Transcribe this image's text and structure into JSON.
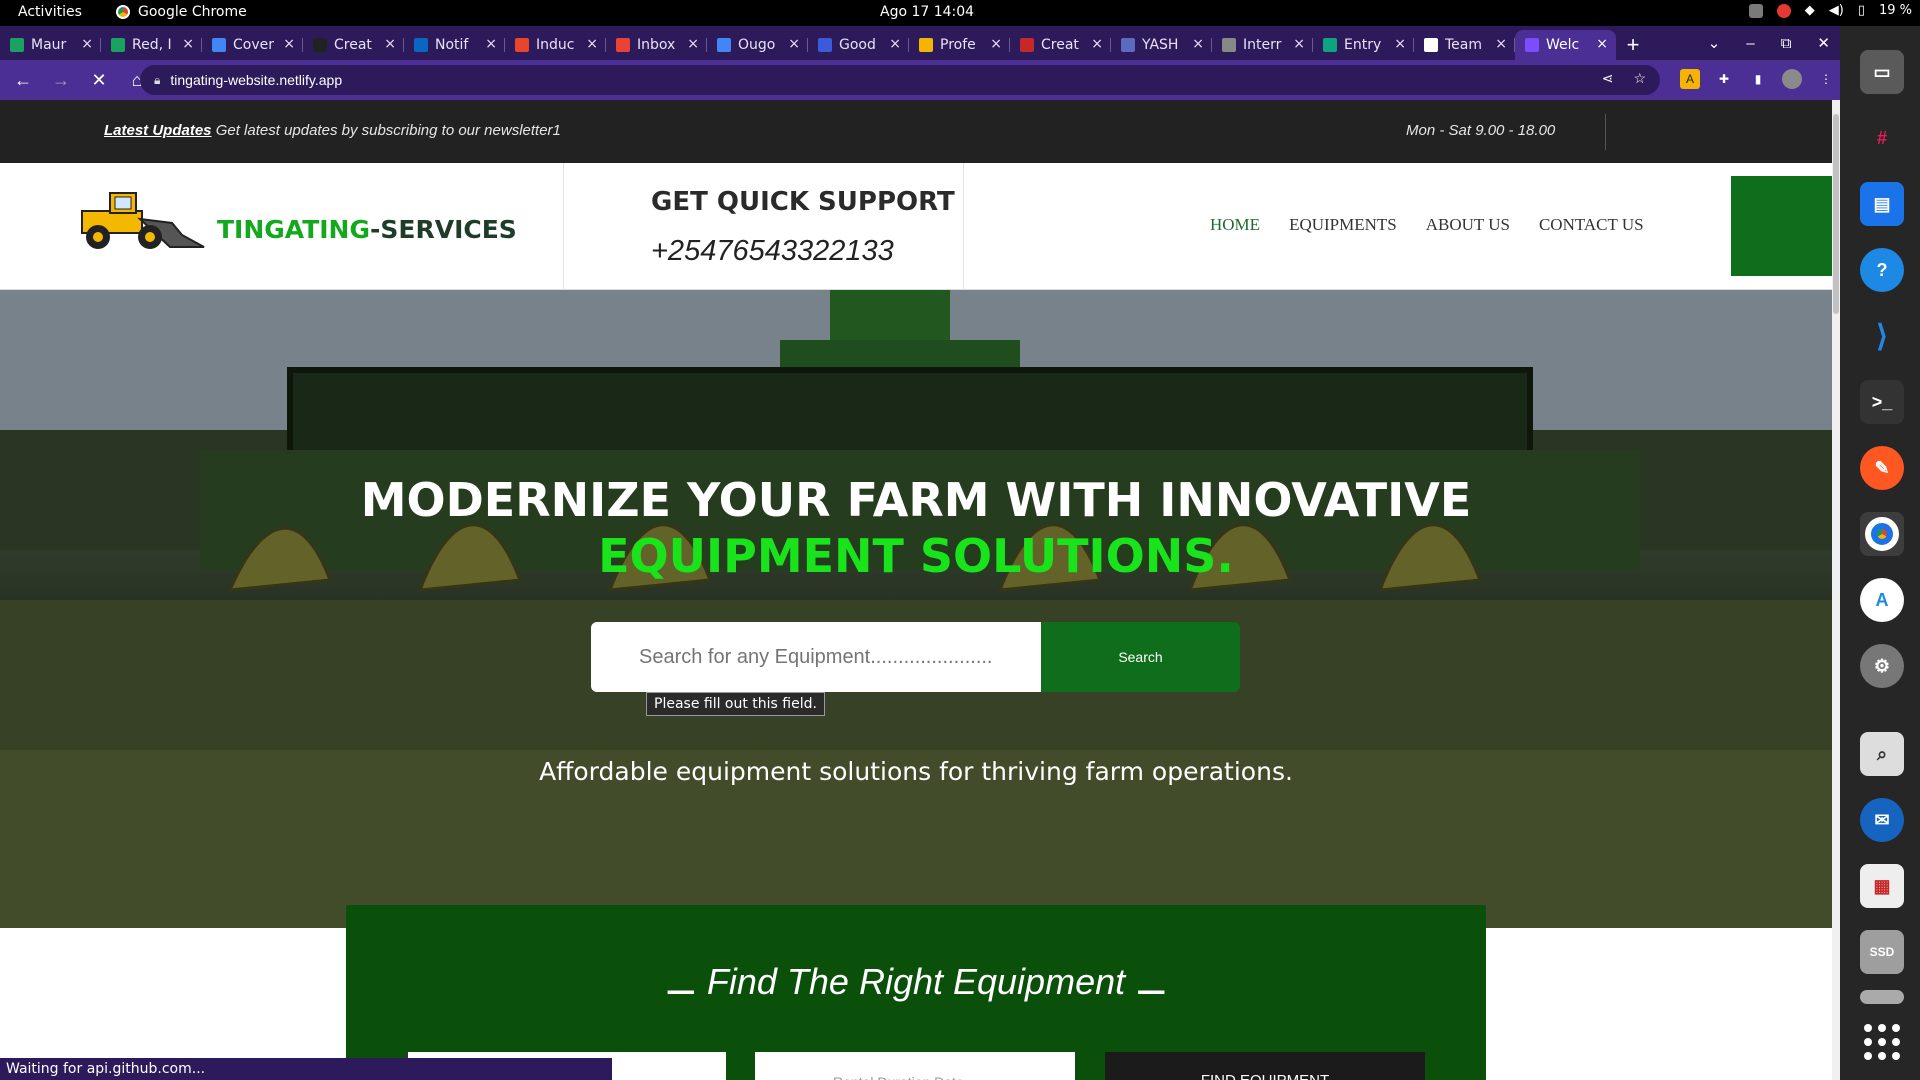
{
  "system": {
    "activities": "Activities",
    "app_name": "Google Chrome",
    "clock": "Ago 17  14:04",
    "battery": "19 %"
  },
  "browser": {
    "tabs": [
      {
        "label": "Maur",
        "color": "#1aa260"
      },
      {
        "label": "Red, I",
        "color": "#1aa260"
      },
      {
        "label": "Cover",
        "color": "#4285f4"
      },
      {
        "label": "Creat",
        "color": "#222222"
      },
      {
        "label": "Notif",
        "color": "#0a66c2"
      },
      {
        "label": "Induc",
        "color": "#e8452c"
      },
      {
        "label": "Inbox",
        "color": "#ea4335"
      },
      {
        "label": "Ougo",
        "color": "#4285f4"
      },
      {
        "label": "Good",
        "color": "#3b5bdb"
      },
      {
        "label": "Profe",
        "color": "#f4b400"
      },
      {
        "label": "Creat",
        "color": "#c62828"
      },
      {
        "label": "YASH",
        "color": "#5c6bc0"
      },
      {
        "label": "Interr",
        "color": "#888888"
      },
      {
        "label": "Entry",
        "color": "#10a37f"
      },
      {
        "label": "Team",
        "color": "#ffffff"
      },
      {
        "label": "Welc",
        "color": "#7c4dff",
        "active": true
      }
    ],
    "url": "tingating-website.netlify.app",
    "status_text": "Waiting for api.github.com..."
  },
  "site": {
    "topbar": {
      "latest_label": "Latest Updates",
      "latest_text": " Get latest updates by subscribing to our newsletter1",
      "hours": "Mon - Sat 9.00 - 18.00"
    },
    "brand": {
      "part1": "TINGATING",
      "part2": "-SERVICES"
    },
    "support": {
      "title": "GET QUICK SUPPORT",
      "phone": "+25476543322133"
    },
    "nav": [
      {
        "label": "HOME",
        "active": true
      },
      {
        "label": "EQUIPMENTS"
      },
      {
        "label": "ABOUT US"
      },
      {
        "label": "CONTACT US"
      }
    ],
    "hero": {
      "title_line1": "MODERNIZE YOUR FARM WITH INNOVATIVE",
      "title_line2": "EQUIPMENT SOLUTIONS.",
      "search_placeholder": "Search for any Equipment......................",
      "search_button": "Search",
      "validation_tooltip": "Please fill out this field.",
      "subtitle": "Affordable equipment solutions for thriving farm operations."
    },
    "find": {
      "title": "Find The Right Equipment",
      "field2_placeholder": "Rental Duration Date",
      "button": "FIND EQUIPMENT"
    },
    "colors": {
      "brand_green": "#0f6e1b",
      "accent_green": "#19e31a",
      "dark_section": "#0a4f0a"
    }
  }
}
